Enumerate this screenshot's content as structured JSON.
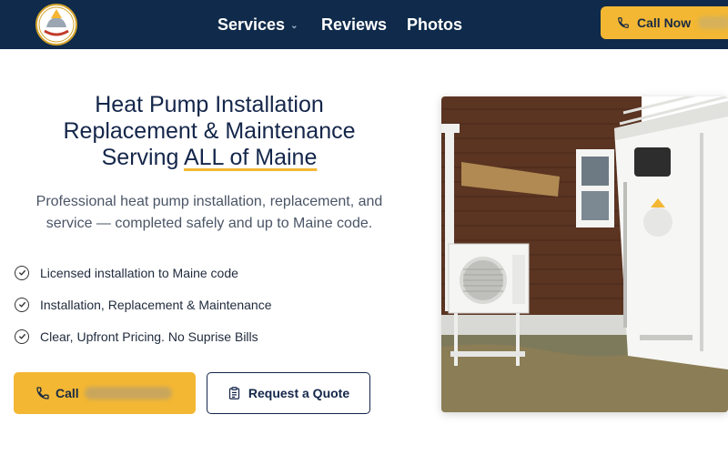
{
  "header": {
    "logo": {
      "icon": "company-logo-icon",
      "alt": ""
    },
    "nav": [
      {
        "label": "Services",
        "has_dropdown": true
      },
      {
        "label": "Reviews"
      },
      {
        "label": "Photos"
      }
    ],
    "call_now_label": "Call Now"
  },
  "hero": {
    "headline_line1": "Heat Pump Installation",
    "headline_line2": "Replacement & Maintenance",
    "headline_line3_prefix": "Serving ",
    "headline_line3_highlight": "ALL of Maine",
    "subtext": "Professional heat pump installation, replacement, and service — completed safely and up to Maine code.",
    "features": [
      "Licensed installation to Maine code",
      "Installation, Replacement & Maintenance",
      "Clear, Upfront Pricing. No Suprise Bills"
    ],
    "call_button_label": "Call",
    "quote_button_label": "Request a Quote",
    "photo": {
      "subject": "heat-pump-outdoor-unit-beside-trailer",
      "trailer_text": "EZ-Haulertrailers.com"
    }
  },
  "colors": {
    "header_bg": "#0f2a4a",
    "accent_yellow": "#f3b733",
    "navy_text": "#14264a"
  }
}
